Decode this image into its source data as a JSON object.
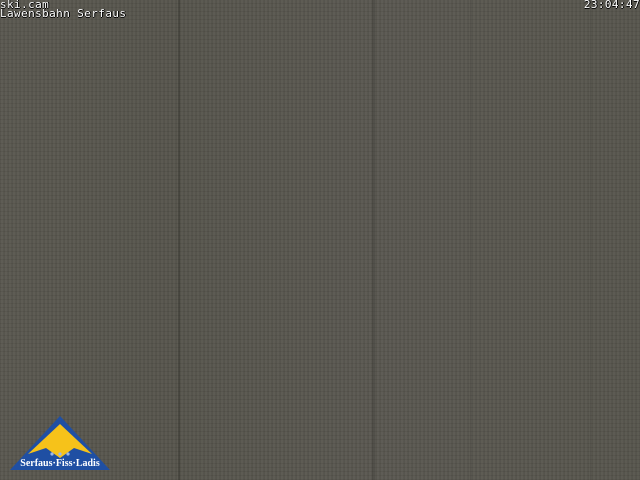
{
  "overlay": {
    "source": "ski.cam",
    "location": "Lawensbahn Serfaus",
    "time": "23:04:47"
  },
  "logo": {
    "text": "Serfaus·Fiss·Ladis",
    "colors": {
      "blue": "#1f4fa3",
      "yellow": "#f6c21a",
      "white": "#ffffff"
    }
  },
  "scene": {
    "base_color": "#59574f"
  }
}
